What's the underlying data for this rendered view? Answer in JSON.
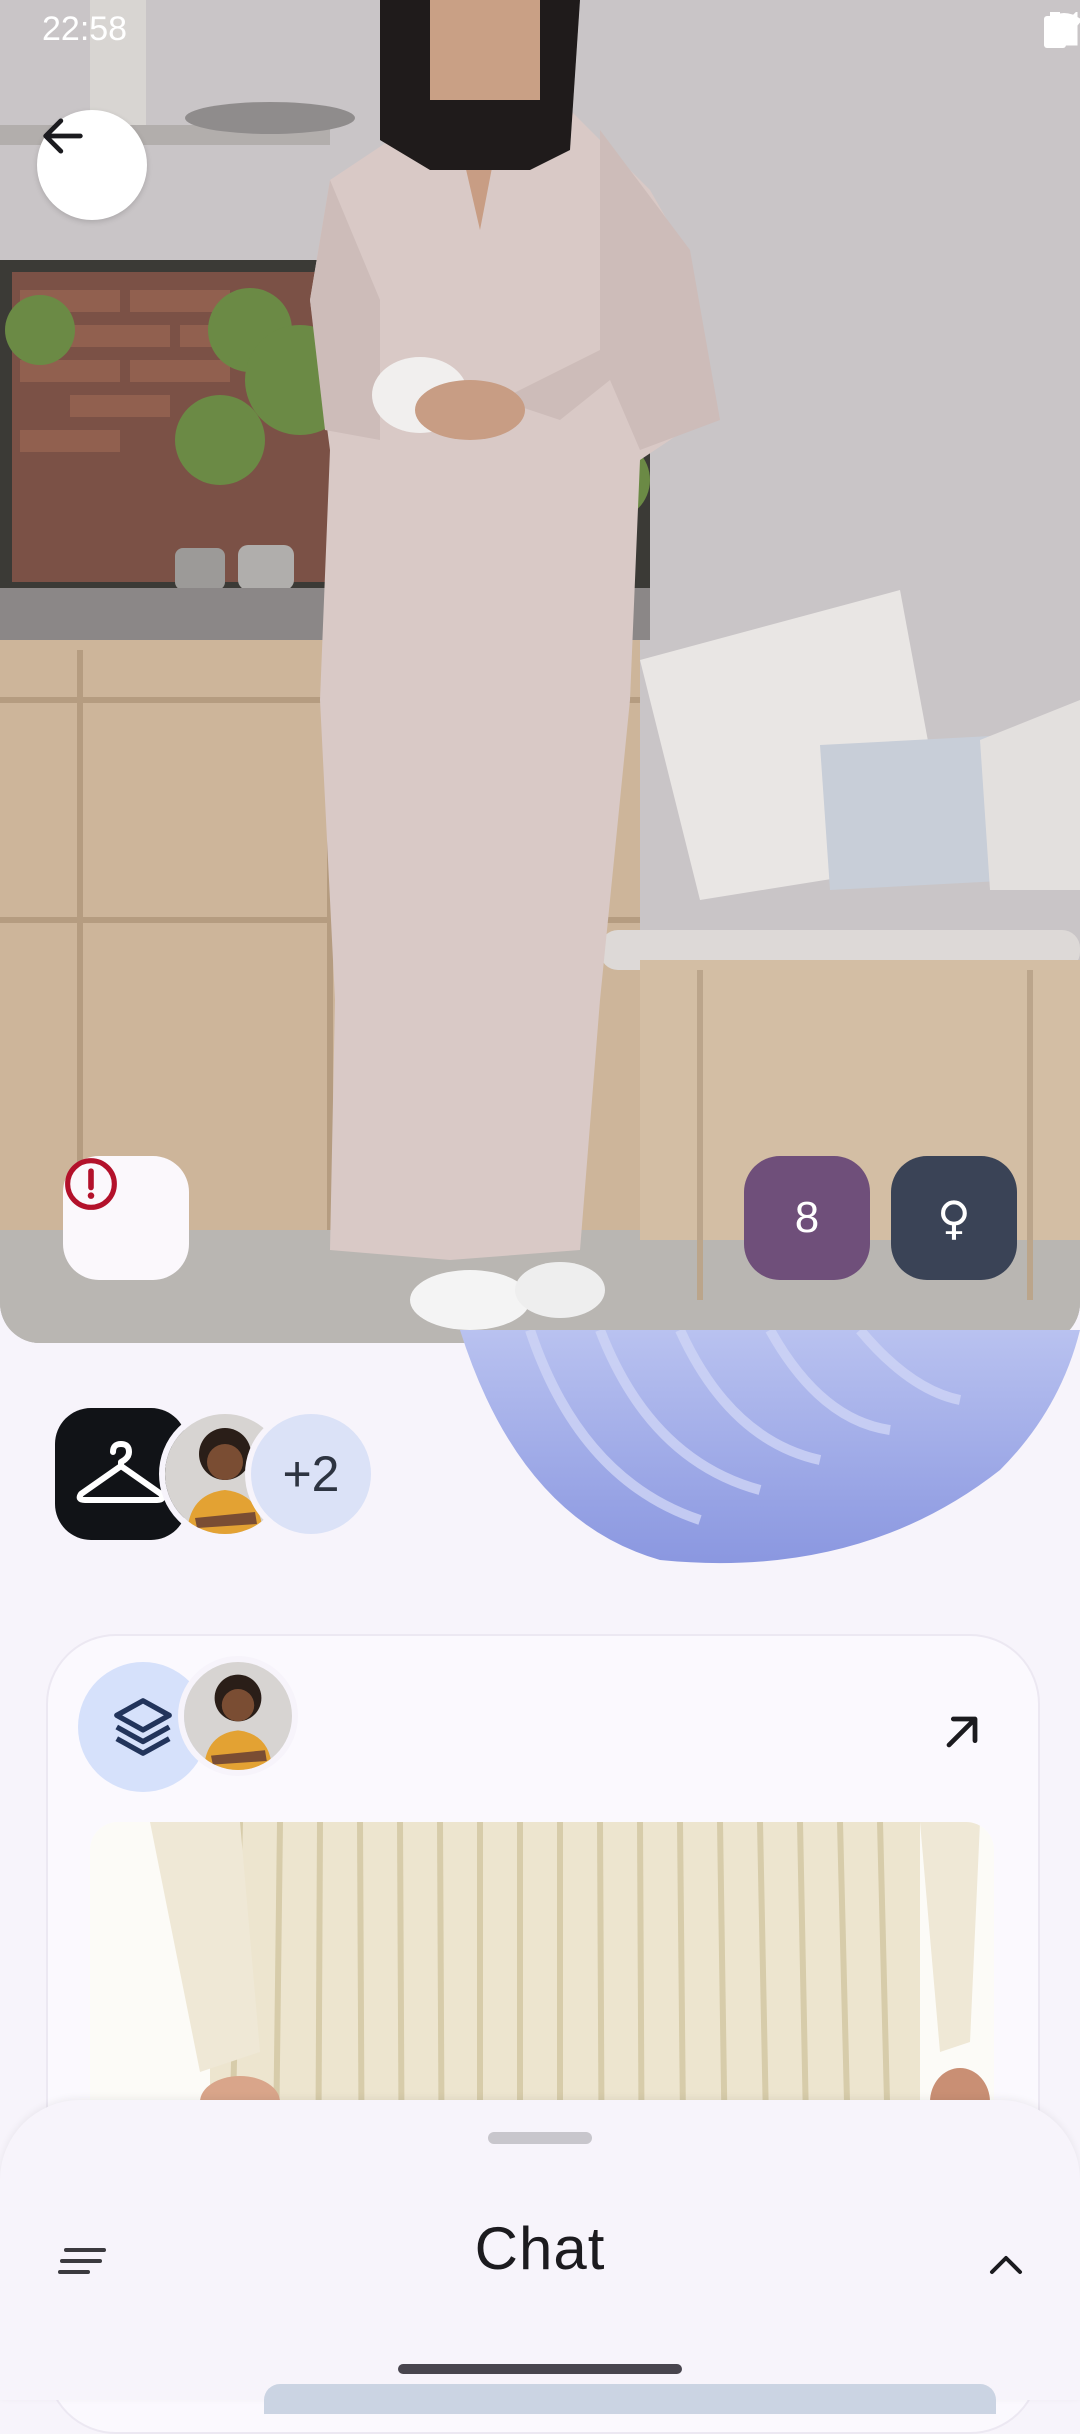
{
  "status_bar": {
    "time": "22:58"
  },
  "hero": {
    "back_icon": "arrow-left-icon",
    "report_icon": "alert-circle-icon",
    "size_badge": "8",
    "gender_badge": "♀",
    "colors": {
      "report_icon": "#b3112b",
      "size_badge_bg": "#6f4f7a",
      "gender_badge_bg": "#3a4356"
    }
  },
  "collaborators": {
    "extra_count": "+2",
    "icon": "hanger-icon"
  },
  "card": {
    "layers_icon": "layers-icon",
    "open_icon": "arrow-up-right-icon"
  },
  "bottom_sheet": {
    "title": "Chat",
    "menu_icon": "menu-icon",
    "expand_icon": "chevron-up-icon"
  }
}
